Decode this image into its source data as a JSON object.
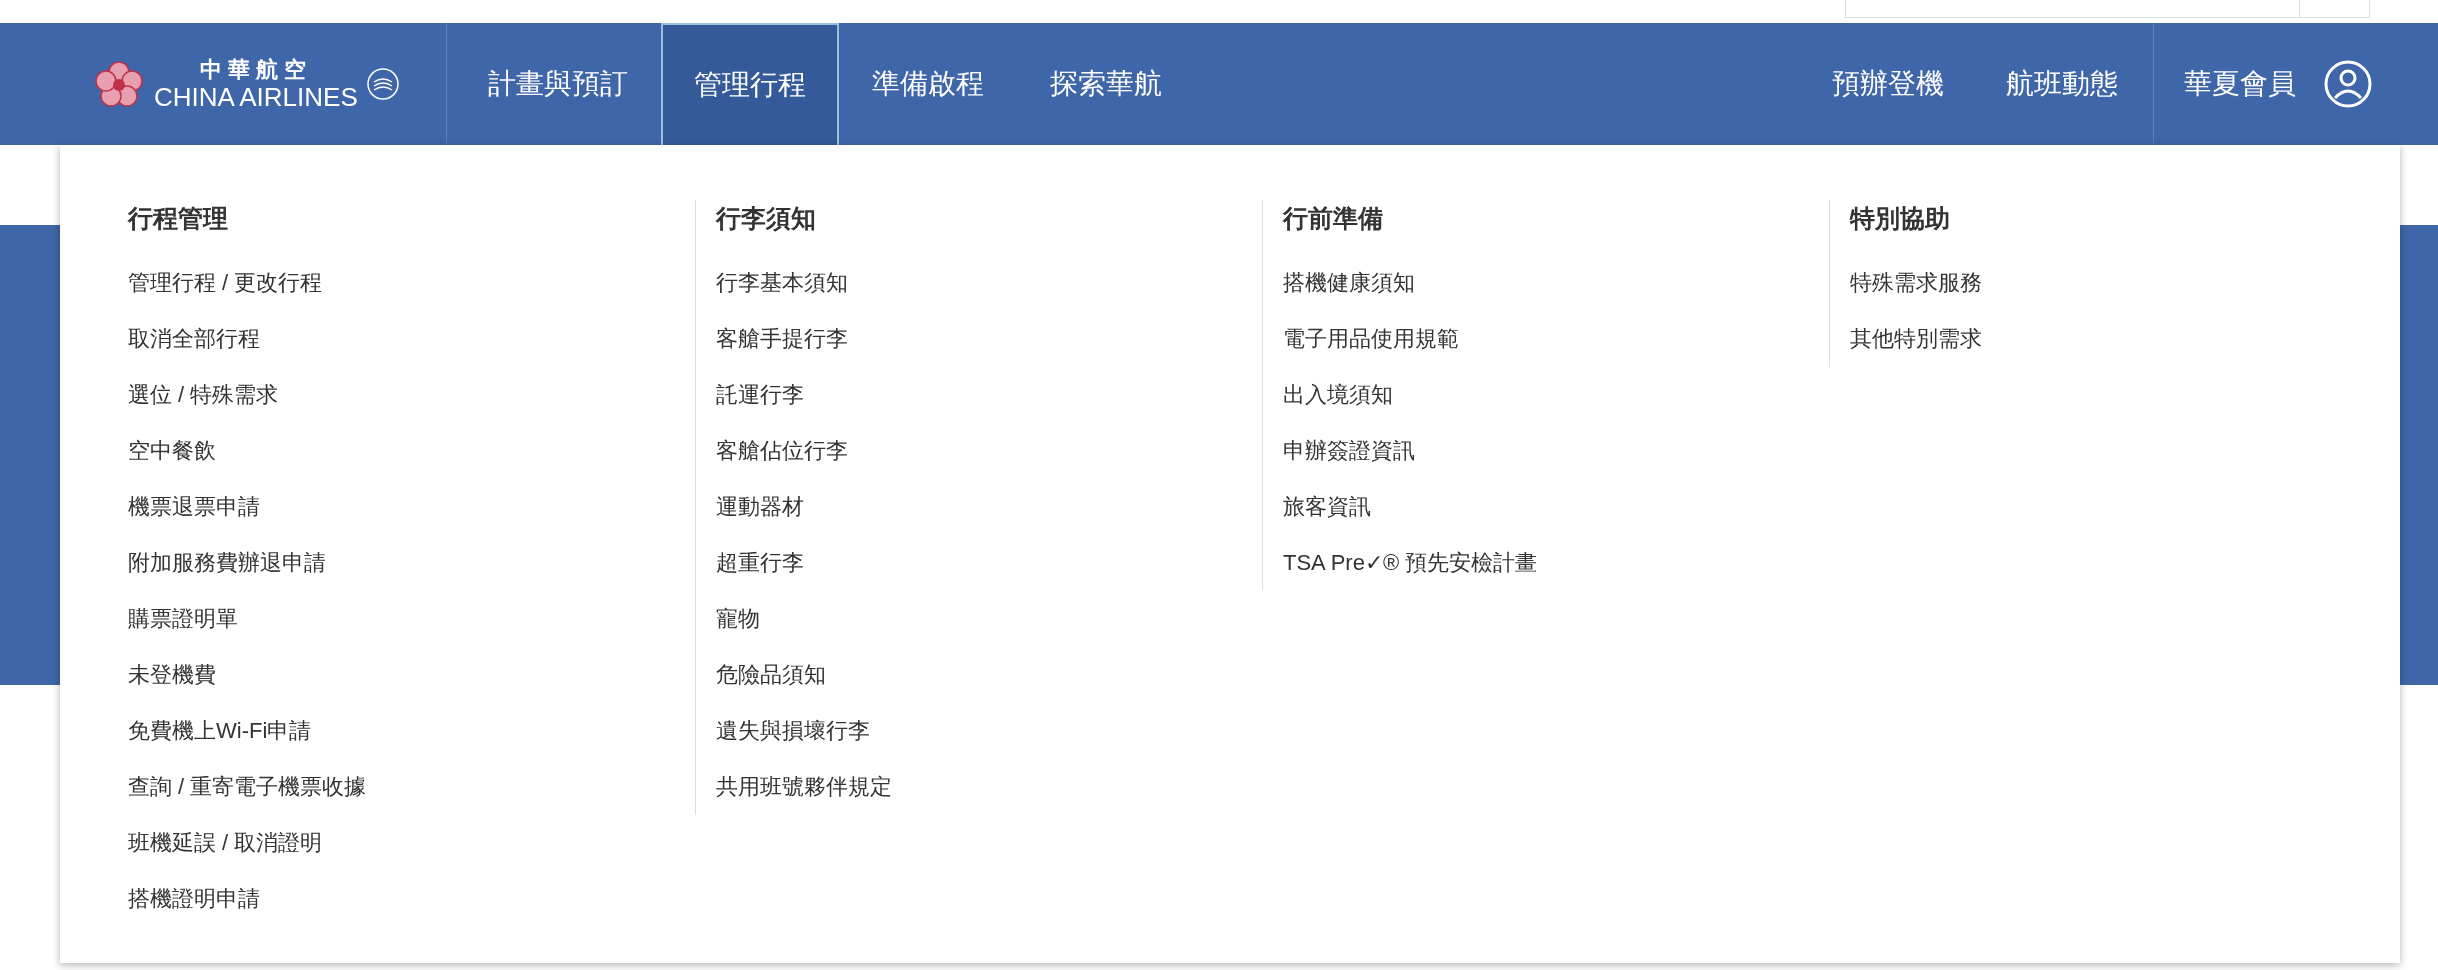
{
  "logo": {
    "chinese": "中華航空",
    "english": "CHINA AIRLINES"
  },
  "nav": [
    {
      "label": "計畫與預訂",
      "selected": false
    },
    {
      "label": "管理行程",
      "selected": true
    },
    {
      "label": "準備啟程",
      "selected": false
    },
    {
      "label": "探索華航",
      "selected": false
    }
  ],
  "nav_right": [
    "預辦登機",
    "航班動態"
  ],
  "member": {
    "label": "華夏會員"
  },
  "dropdown": {
    "columns": [
      {
        "heading": "行程管理",
        "items": [
          "管理行程 / 更改行程",
          "取消全部行程",
          "選位 / 特殊需求",
          "空中餐飲",
          "機票退票申請",
          "附加服務費辦退申請",
          "購票證明單",
          "未登機費",
          "免費機上Wi-Fi申請",
          "查詢 / 重寄電子機票收據",
          "班機延誤 / 取消證明",
          "搭機證明申請"
        ]
      },
      {
        "heading": "行李須知",
        "items": [
          "行李基本須知",
          "客艙手提行李",
          "託運行李",
          "客艙佔位行李",
          "運動器材",
          "超重行李",
          "寵物",
          "危險品須知",
          "遺失與損壞行李",
          "共用班號夥伴規定"
        ]
      },
      {
        "heading": "行前準備",
        "items": [
          "搭機健康須知",
          "電子用品使用規範",
          "出入境須知",
          "申辦簽證資訊",
          "旅客資訊",
          "TSA Pre✓® 預先安檢計畫"
        ]
      },
      {
        "heading": "特別協助",
        "items": [
          "特殊需求服務",
          "其他特別需求"
        ]
      }
    ]
  }
}
